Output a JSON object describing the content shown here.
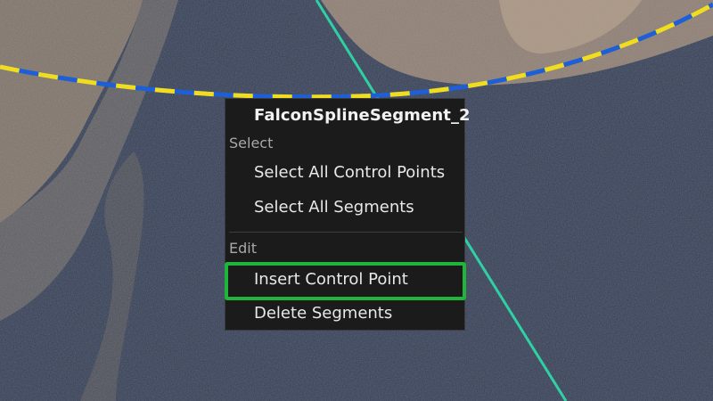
{
  "viewport": {
    "background": "aerial-terrain",
    "spline_colors": [
      "#1f5fd6",
      "#f2dc1e"
    ],
    "guide_line_color": "#2fd0a3"
  },
  "context_menu": {
    "title": "FalconSplineSegment_2",
    "sections": [
      {
        "header": "Select",
        "items": [
          {
            "label": "Select All Control Points"
          },
          {
            "label": "Select All Segments"
          }
        ]
      },
      {
        "header": "Edit",
        "items": [
          {
            "label": "Insert Control Point",
            "highlighted": true
          },
          {
            "label": "Delete Segments"
          }
        ]
      }
    ],
    "highlight_color": "#1fb53a"
  }
}
